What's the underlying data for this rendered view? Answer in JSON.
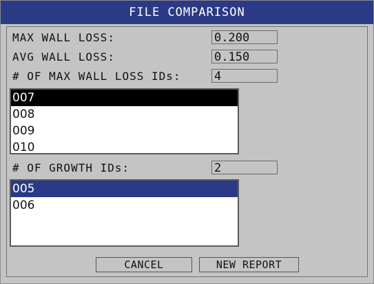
{
  "title": "FILE COMPARISON",
  "fields": {
    "max_wall_loss": {
      "label": "MAX WALL LOSS:",
      "value": "0.200"
    },
    "avg_wall_loss": {
      "label": "AVG WALL LOSS:",
      "value": "0.150"
    },
    "max_wall_loss_ids": {
      "label": "# OF MAX WALL LOSS IDs:",
      "value": "4"
    },
    "growth_ids": {
      "label": "# OF GROWTH IDs:",
      "value": "2"
    }
  },
  "max_wall_loss_list": [
    "007",
    "008",
    "009",
    "010"
  ],
  "growth_list": [
    "005",
    "006"
  ],
  "buttons": {
    "cancel": "CANCEL",
    "new_report": "NEW REPORT"
  },
  "colors": {
    "title_bar": "#2b3a86",
    "background": "#c4c4c4",
    "selection_black": "#000000",
    "selection_blue": "#2b3a86"
  }
}
